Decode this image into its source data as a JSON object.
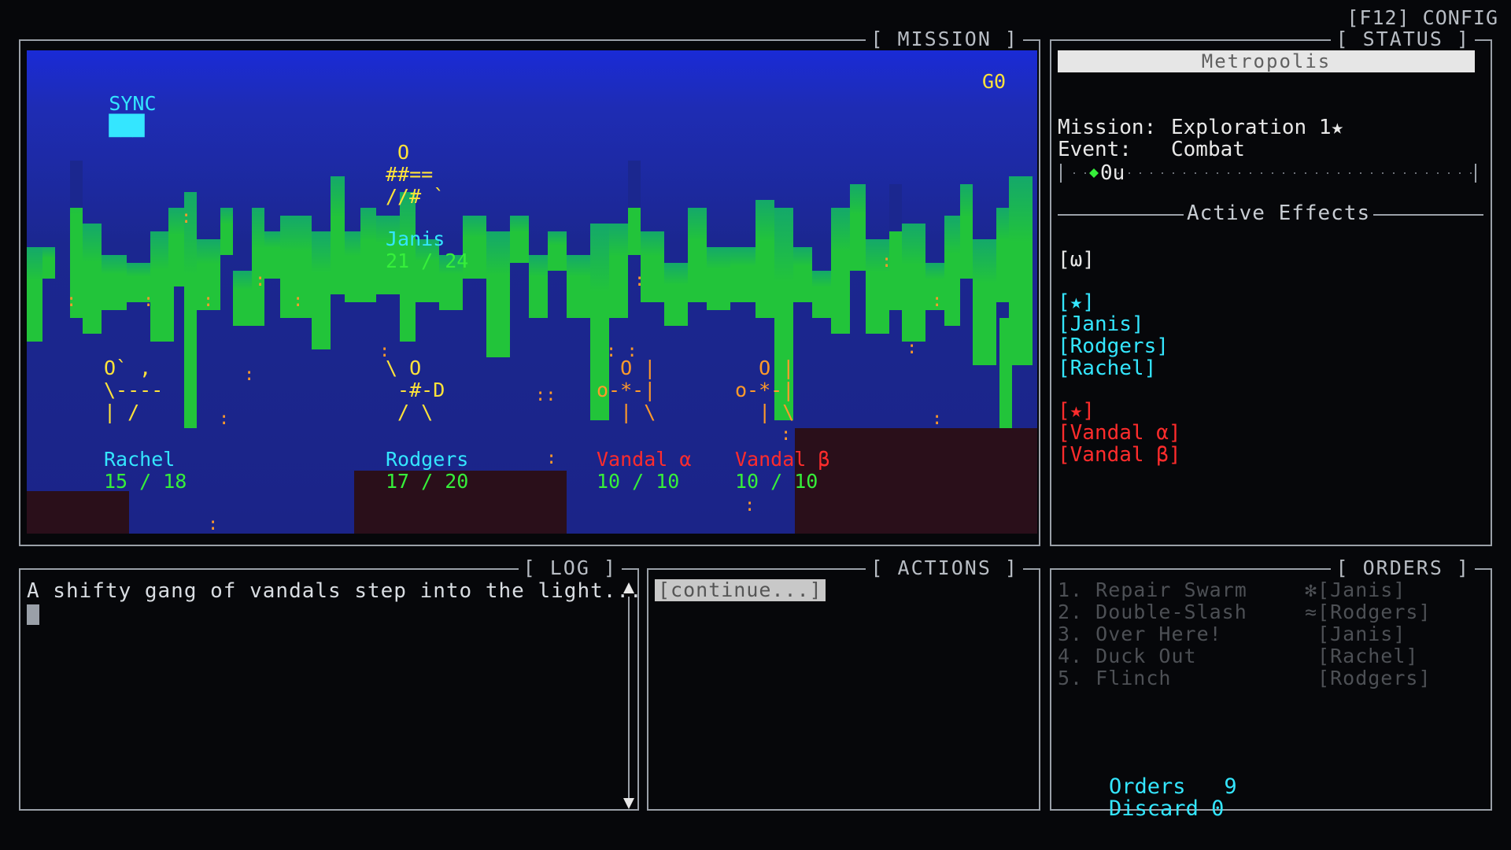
{
  "config_label": "[F12] CONFIG",
  "panels": {
    "mission": "[ MISSION ]",
    "status": "[ STATUS ]",
    "log": "[ LOG ]",
    "actions": "[ ACTIONS ]",
    "orders": "[ ORDERS ]"
  },
  "scene": {
    "sync_label": "SYNC",
    "sync_bars": 3,
    "gold": "G0",
    "units": [
      {
        "name": "Janis",
        "hp": "21 / 24",
        "sprite": " O\n##==\n//# `",
        "team": "ally"
      },
      {
        "name": "Rachel",
        "hp": "15 / 18",
        "sprite": "O` ,\n\\----\n| /",
        "team": "ally"
      },
      {
        "name": "Rodgers",
        "hp": "17 / 20",
        "sprite": "\\ O\n -#-D\n / \\",
        "team": "ally"
      },
      {
        "name": "Vandal α",
        "hp": "10 / 10",
        "sprite": "  O |\no-*-|\n  | \\",
        "team": "enemy"
      },
      {
        "name": "Vandal β",
        "hp": "10 / 10",
        "sprite": "  O |\no-*-|\n  | \\",
        "team": "enemy"
      }
    ]
  },
  "status": {
    "location": "Metropolis",
    "mission_label": "Mission:",
    "mission_value": "Exploration 1★",
    "event_label": "Event:",
    "event_value": "Combat",
    "track_value": "0u",
    "active_effects_title": "Active Effects",
    "effect_global": "[ω]",
    "ally_marker": "[★]",
    "allies": [
      "[Janis]",
      "[Rodgers]",
      "[Rachel]"
    ],
    "enemy_marker": "[★]",
    "enemies": [
      "[Vandal α]",
      "[Vandal β]"
    ]
  },
  "log": {
    "lines": [
      "A shifty gang of vandals step into the light..."
    ]
  },
  "actions": {
    "continue_label": "[continue...]"
  },
  "orders": {
    "items": [
      {
        "label": "1. Repair Swarm",
        "who": "✻[Janis]"
      },
      {
        "label": "2. Double-Slash",
        "who": "≈[Rodgers]"
      },
      {
        "label": "3. Over Here!",
        "who": " [Janis]"
      },
      {
        "label": "4. Duck Out",
        "who": " [Rachel]"
      },
      {
        "label": "5. Flinch",
        "who": " [Rodgers]"
      }
    ],
    "orders_label": "Orders",
    "orders_count": "9",
    "discard_label": "Discard",
    "discard_count": "0"
  },
  "colors": {
    "ally": "#34e6ff",
    "enemy": "#ff2c2c",
    "hp": "#36ef3a",
    "sprite_ally": "#ffe33a",
    "sprite_enemy": "#ff9a2a"
  }
}
